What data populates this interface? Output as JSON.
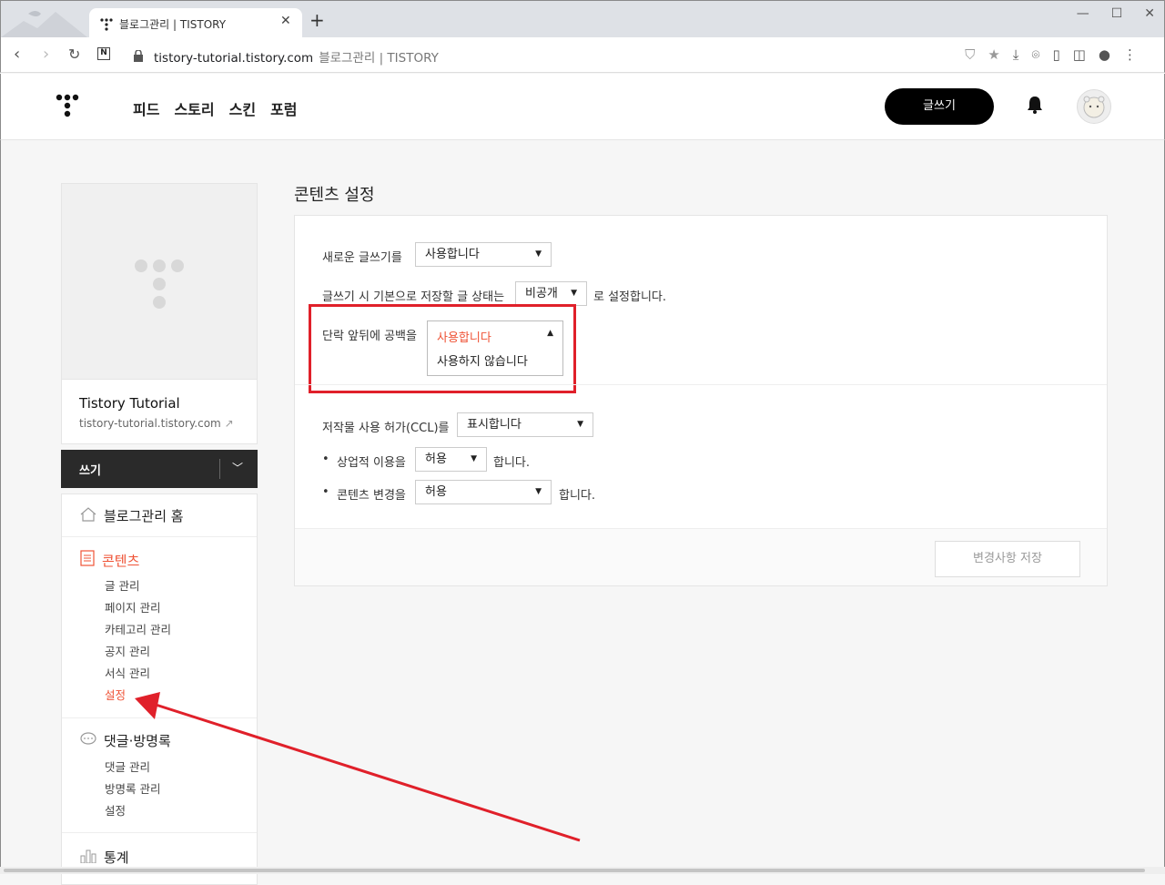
{
  "browser": {
    "tab_title": "블로그관리 | TISTORY",
    "new_tab": "+",
    "url_domain": "tistory-tutorial.tistory.com",
    "url_title": "블로그관리 | TISTORY",
    "window_controls": {
      "minimize": "—",
      "maximize": "☐",
      "close": "✕"
    }
  },
  "header": {
    "nav": [
      "피드",
      "스토리",
      "스킨",
      "포럼"
    ],
    "write_button": "글쓰기"
  },
  "sidebar": {
    "blog_title": "Tistory Tutorial",
    "blog_url": "tistory-tutorial.tistory.com",
    "write_label": "쓰기",
    "home_label": "블로그관리 홈",
    "contents_label": "콘텐츠",
    "contents_items": [
      "글 관리",
      "페이지 관리",
      "카테고리 관리",
      "공지 관리",
      "서식 관리",
      "설정"
    ],
    "comments_label": "댓글·방명록",
    "comments_items": [
      "댓글 관리",
      "방명록 관리",
      "설정"
    ],
    "stats_label": "통계"
  },
  "main": {
    "title": "콘텐츠 설정",
    "new_editor_label": "새로운 글쓰기를",
    "new_editor_value": "사용합니다",
    "default_status_label": "글쓰기 시 기본으로 저장할 글 상태는",
    "default_status_value": "비공개",
    "default_status_suffix": "로 설정합니다.",
    "paragraph_label": "단락 앞뒤에 공백을",
    "paragraph_options": [
      "사용합니다",
      "사용하지 않습니다"
    ],
    "ccl_label": "저작물 사용 허가(CCL)를",
    "ccl_value": "표시합니다",
    "commercial_label": "상업적 이용을",
    "commercial_value": "허용",
    "commercial_suffix": "합니다.",
    "modify_label": "콘텐츠 변경을",
    "modify_value": "허용",
    "modify_suffix": "합니다.",
    "save_button": "변경사항 저장"
  },
  "colors": {
    "accent_red": "#e0202a",
    "active_menu": "#ef5336"
  }
}
